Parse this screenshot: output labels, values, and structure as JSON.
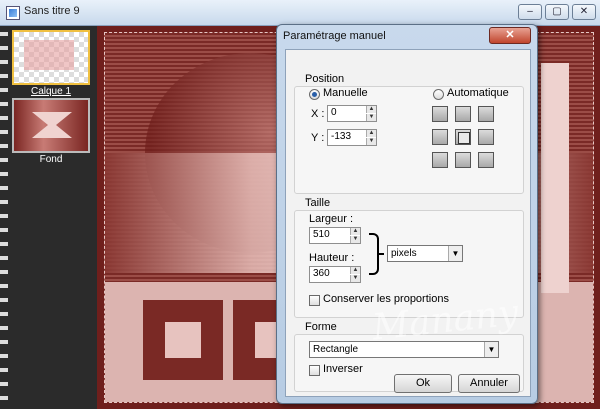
{
  "window": {
    "title": "Sans titre 9",
    "controls": [
      "–",
      "▢",
      "✕"
    ]
  },
  "layers": [
    {
      "name": "Calque 1",
      "selected": true
    },
    {
      "name": "Fond",
      "selected": false
    }
  ],
  "dialog": {
    "title": "Paramétrage manuel",
    "close_label": "✕",
    "position": {
      "label": "Position",
      "manual_label": "Manuelle",
      "auto_label": "Automatique",
      "mode": "Manuelle",
      "x_label": "X :",
      "x_value": "0",
      "y_label": "Y :",
      "y_value": "-133",
      "anchor_selected": "center"
    },
    "size": {
      "label": "Taille",
      "width_label": "Largeur :",
      "width_value": "510",
      "height_label": "Hauteur :",
      "height_value": "360",
      "unit_value": "pixels",
      "keep_ratio_label": "Conserver les proportions",
      "keep_ratio_checked": false
    },
    "shape": {
      "label": "Forme",
      "shape_value": "Rectangle",
      "invert_label": "Inverser",
      "invert_checked": false
    },
    "ok_label": "Ok",
    "cancel_label": "Annuler"
  },
  "watermark": "Manany",
  "colors": {
    "canvas_dark": "#6f1f1c",
    "canvas_light": "#f3d7d4",
    "dialog_frame": "#c8d9ec",
    "close_red": "#c0452d"
  }
}
